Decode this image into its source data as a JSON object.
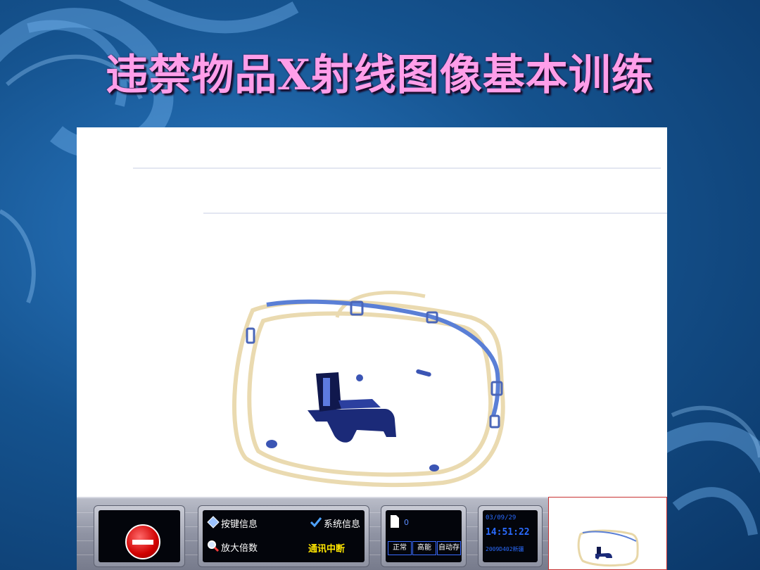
{
  "slide": {
    "title": "违禁物品X射线图像基本训练"
  },
  "xray": {
    "objects": [
      "bag-outline",
      "handle",
      "gun"
    ]
  },
  "control_panel": {
    "alarm_icon": "stop-icon",
    "menu": {
      "key_info_label": "按键信息",
      "key_info_icon": "diamond-key-icon",
      "zoom_label": "放大倍数",
      "zoom_icon": "magnifier-icon",
      "system_info_label": "系统信息",
      "system_info_icon": "check-icon",
      "comm_status": "通讯中断"
    },
    "counter": {
      "value": "0",
      "icon": "document-icon",
      "modes": [
        "正常",
        "高能",
        "自动存"
      ]
    },
    "clock": {
      "date": "03/09/29",
      "time": "14:51:22",
      "code": "2009D402新疆"
    }
  },
  "colors": {
    "title": "#ff9ee9",
    "comm_status": "#ffe600",
    "clock": "#2a6bff",
    "bag_outline": "#e8d7a8",
    "strap": "#5a7fd6",
    "gun": "#1b2a78"
  }
}
